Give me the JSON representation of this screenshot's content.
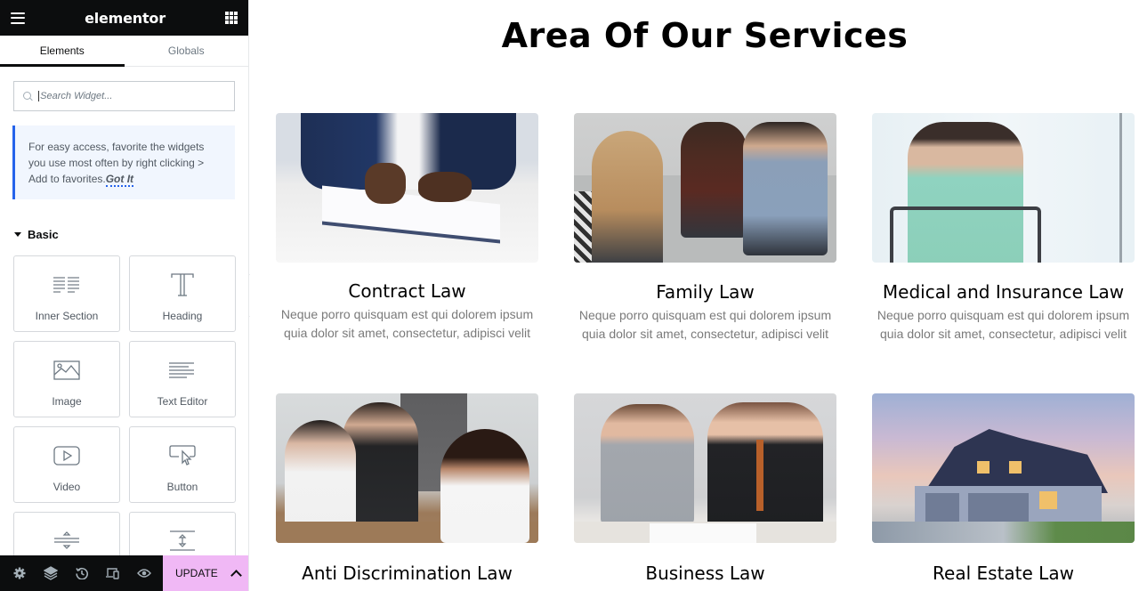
{
  "panel": {
    "brand": "elementor",
    "tabs": [
      {
        "label": "Elements",
        "active": true
      },
      {
        "label": "Globals",
        "active": false
      }
    ],
    "search": {
      "placeholder": "Search Widget...",
      "value": ""
    },
    "notice": {
      "text": "For easy access, favorite the widgets you use most often by right clicking > Add to favorites.",
      "link": "Got It"
    },
    "category": "Basic",
    "widgets": [
      {
        "label": "Inner Section",
        "icon": "inner-section-icon"
      },
      {
        "label": "Heading",
        "icon": "heading-icon"
      },
      {
        "label": "Image",
        "icon": "image-icon"
      },
      {
        "label": "Text Editor",
        "icon": "text-editor-icon"
      },
      {
        "label": "Video",
        "icon": "video-icon"
      },
      {
        "label": "Button",
        "icon": "button-icon"
      },
      {
        "label": "",
        "icon": "divider-icon"
      },
      {
        "label": "",
        "icon": "spacer-icon"
      }
    ],
    "footer": {
      "tools": [
        "settings-icon",
        "navigator-layers-icon",
        "history-icon",
        "responsive-mode-icon",
        "preview-eye-icon"
      ],
      "update_label": "UPDATE"
    }
  },
  "colors": {
    "header_bg": "#0c0d0e",
    "update_bg": "#f0b8f5",
    "notice_bg": "#f1f6fe",
    "notice_accent": "#2563eb"
  },
  "canvas": {
    "title": "Area Of Our Services",
    "services": [
      {
        "title": "Contract Law",
        "description": "Neque porro quisquam est qui dolorem ipsum quia dolor sit amet, consectetur, adipisci velit",
        "image": "person signing document"
      },
      {
        "title": "Family Law",
        "description": "Neque porro quisquam est qui dolorem ipsum quia dolor sit amet, consectetur, adipisci velit",
        "image": "couple talking with counselor"
      },
      {
        "title": "Medical and Insurance Law",
        "description": "Neque porro quisquam est qui dolorem ipsum quia dolor sit amet, consectetur, adipisci velit",
        "image": "patient in wheelchair"
      },
      {
        "title": "Anti Discrimination Law",
        "description": "",
        "image": "stressed woman in office meeting"
      },
      {
        "title": "Business Law",
        "description": "",
        "image": "businessmen shaking hands"
      },
      {
        "title": "Real Estate Law",
        "description": "",
        "image": "suburban house at dusk"
      }
    ]
  }
}
